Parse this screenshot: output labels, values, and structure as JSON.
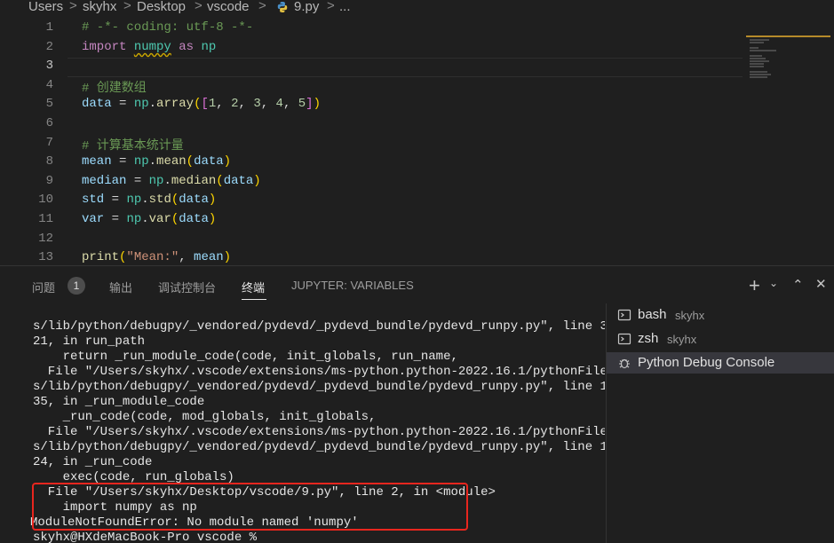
{
  "breadcrumb": {
    "segments": [
      "Users",
      "skyhx",
      "Desktop",
      "vscode",
      "9.py",
      "..."
    ],
    "separator": ">"
  },
  "editor": {
    "line_numbers": [
      "1",
      "2",
      "3",
      "4",
      "5",
      "6",
      "7",
      "8",
      "9",
      "10",
      "11",
      "12",
      "13"
    ],
    "active_line": "3",
    "lines": [
      "# -*- coding: utf-8 -*-",
      "import numpy as np",
      "",
      "# 创建数组",
      "data = np.array([1, 2, 3, 4, 5])",
      "",
      "# 计算基本统计量",
      "mean = np.mean(data)",
      "median = np.median(data)",
      "std = np.std(data)",
      "var = np.var(data)",
      "",
      "print(\"Mean:\", mean)"
    ]
  },
  "panel": {
    "tabs": [
      {
        "label": "问题",
        "badge": "1"
      },
      {
        "label": "输出"
      },
      {
        "label": "调试控制台"
      },
      {
        "label": "终端",
        "active": true
      },
      {
        "label": "JUPYTER: VARIABLES"
      }
    ],
    "actions": {
      "add": "+",
      "dropdown": "⌄",
      "maximize": "⌃",
      "close": "✕"
    }
  },
  "terminal": {
    "lines": [
      "s/lib/python/debugpy/_vendored/pydevd/_pydevd_bundle/pydevd_runpy.py\", line 3",
      "21, in run_path",
      "    return _run_module_code(code, init_globals, run_name,",
      "  File \"/Users/skyhx/.vscode/extensions/ms-python.python-2022.16.1/pythonFile",
      "s/lib/python/debugpy/_vendored/pydevd/_pydevd_bundle/pydevd_runpy.py\", line 1",
      "35, in _run_module_code",
      "    _run_code(code, mod_globals, init_globals,",
      "  File \"/Users/skyhx/.vscode/extensions/ms-python.python-2022.16.1/pythonFile",
      "s/lib/python/debugpy/_vendored/pydevd/_pydevd_bundle/pydevd_runpy.py\", line 1",
      "24, in _run_code",
      "    exec(code, run_globals)",
      "  File \"/Users/skyhx/Desktop/vscode/9.py\", line 2, in <module>",
      "    import numpy as np",
      "ModuleNotFoundError: No module named 'numpy'",
      "skyhx@HXdeMacBook-Pro vscode %"
    ]
  },
  "terminal_list": [
    {
      "name": "bash",
      "detail": "skyhx",
      "icon": "terminal-icon"
    },
    {
      "name": "zsh",
      "detail": "skyhx",
      "icon": "terminal-icon"
    },
    {
      "name": "Python Debug Console",
      "detail": "",
      "icon": "debug-bug-icon",
      "active": true
    }
  ],
  "colors": {
    "error_highlight": "#e8261e",
    "warning_squiggle": "#cca700"
  }
}
